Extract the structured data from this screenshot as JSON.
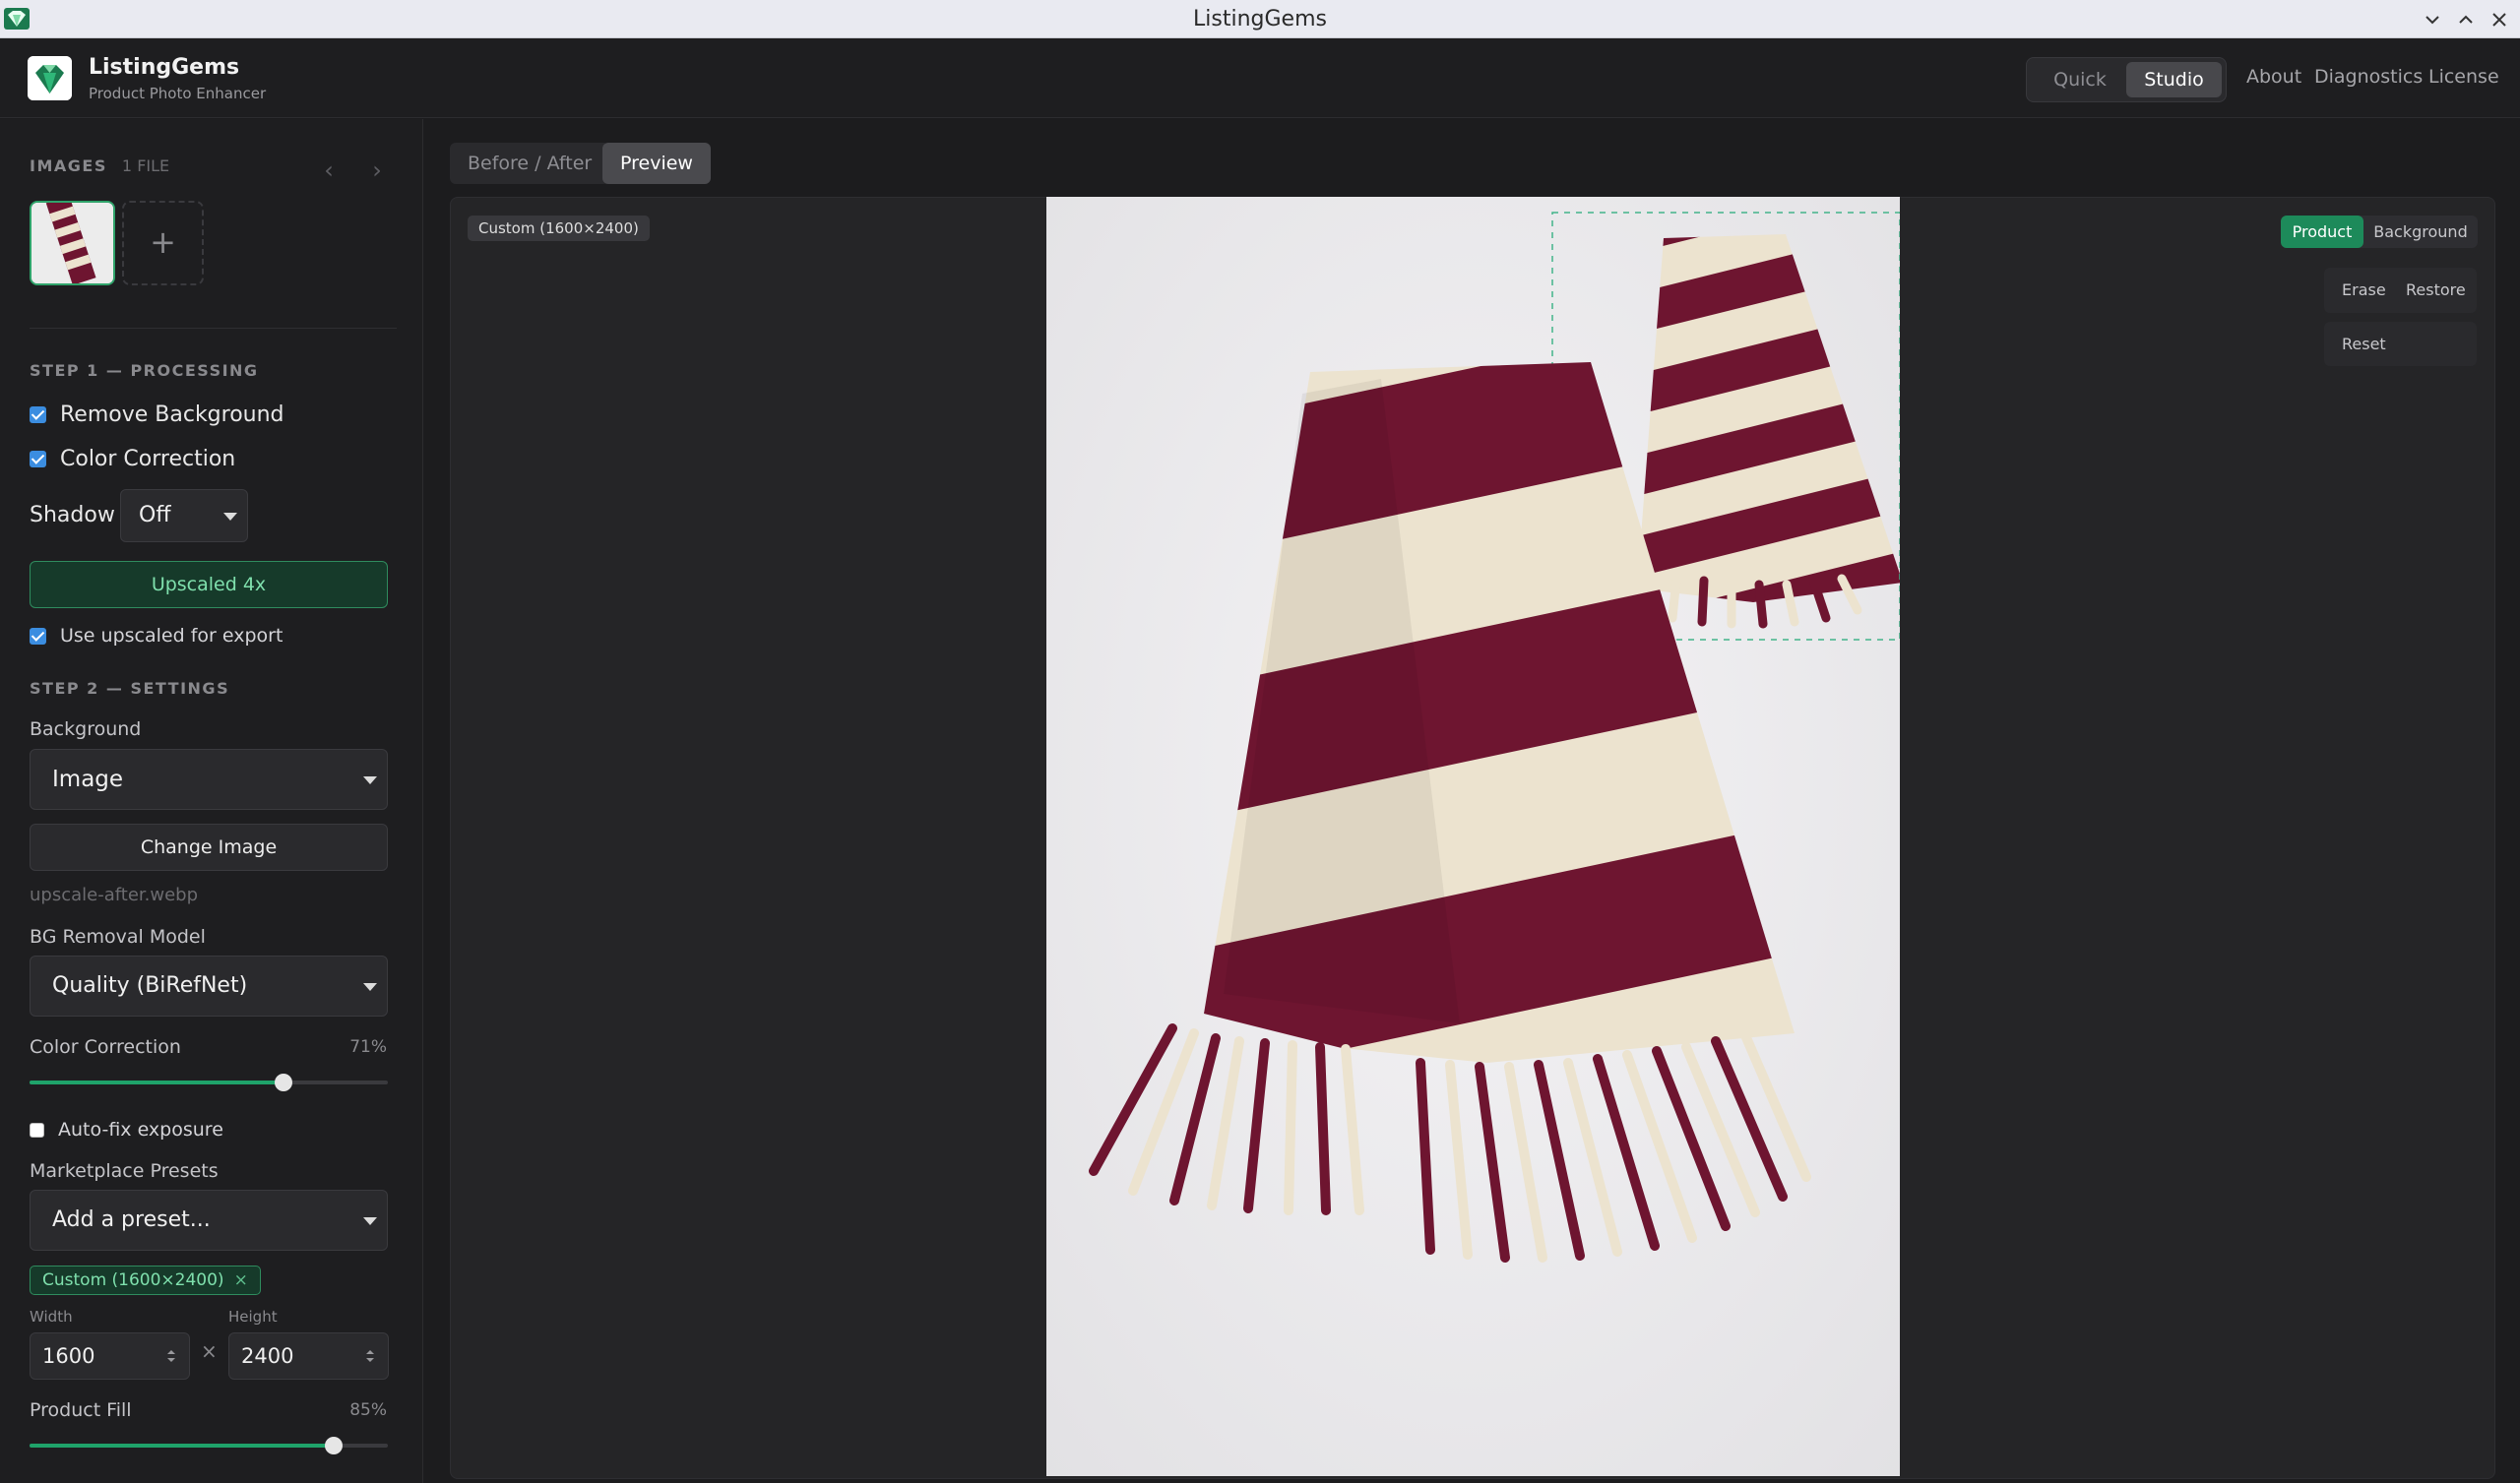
{
  "window": {
    "title": "ListingGems",
    "controls": [
      "minimize-icon",
      "maximize-icon",
      "close-icon"
    ]
  },
  "header": {
    "brand": {
      "name": "ListingGems",
      "tagline": "Product Photo Enhancer"
    },
    "modes": {
      "quick": "Quick",
      "studio": "Studio",
      "active": "Studio"
    },
    "links": {
      "about": "About",
      "diagnostics": "Diagnostics",
      "license": "License"
    }
  },
  "sidebar": {
    "images": {
      "label": "IMAGES",
      "count": "1 file",
      "add_symbol": "+"
    },
    "step1": {
      "label": "STEP 1 — PROCESSING",
      "remove_background": {
        "label": "Remove Background",
        "checked": true
      },
      "color_correction": {
        "label": "Color Correction",
        "checked": true
      },
      "shadow": {
        "label": "Shadow",
        "value": "Off"
      },
      "upscaled_button": "Upscaled 4x",
      "use_upscaled": {
        "label": "Use upscaled for export",
        "checked": true
      }
    },
    "step2": {
      "label": "STEP 2 — SETTINGS",
      "background": {
        "label": "Background",
        "value": "Image"
      },
      "change_image_button": "Change Image",
      "bg_filename": "upscale-after.webp",
      "bg_model": {
        "label": "BG Removal Model",
        "value": "Quality (BiRefNet)"
      },
      "color_correction_slider": {
        "label": "Color Correction",
        "value_text": "71%",
        "value": 0.71
      },
      "auto_fix": {
        "label": "Auto-fix exposure",
        "checked": false
      },
      "presets": {
        "label": "Marketplace Presets",
        "placeholder": "Add a preset..."
      },
      "preset_chip": {
        "label": "Custom (1600×2400)",
        "remove": "×"
      },
      "width": {
        "label": "Width",
        "value": "1600"
      },
      "times": "×",
      "height": {
        "label": "Height",
        "value": "2400"
      },
      "product_fill": {
        "label": "Product Fill",
        "value_text": "85%",
        "value": 0.85
      }
    }
  },
  "main": {
    "tabs": {
      "before_after": "Before / After",
      "preview": "Preview",
      "active": "Preview"
    },
    "size_tag": "Custom (1600×2400)",
    "layer_toggle": {
      "product": "Product",
      "background": "Background",
      "active": "Product"
    },
    "tools": {
      "erase": "Erase",
      "restore": "Restore",
      "reset": "Reset"
    }
  },
  "colors": {
    "accent_green": "#1d8a5a",
    "scarf_maroon": "#6e1530",
    "scarf_cream": "#ece3cf",
    "checkbox_blue": "#3b8de0"
  }
}
